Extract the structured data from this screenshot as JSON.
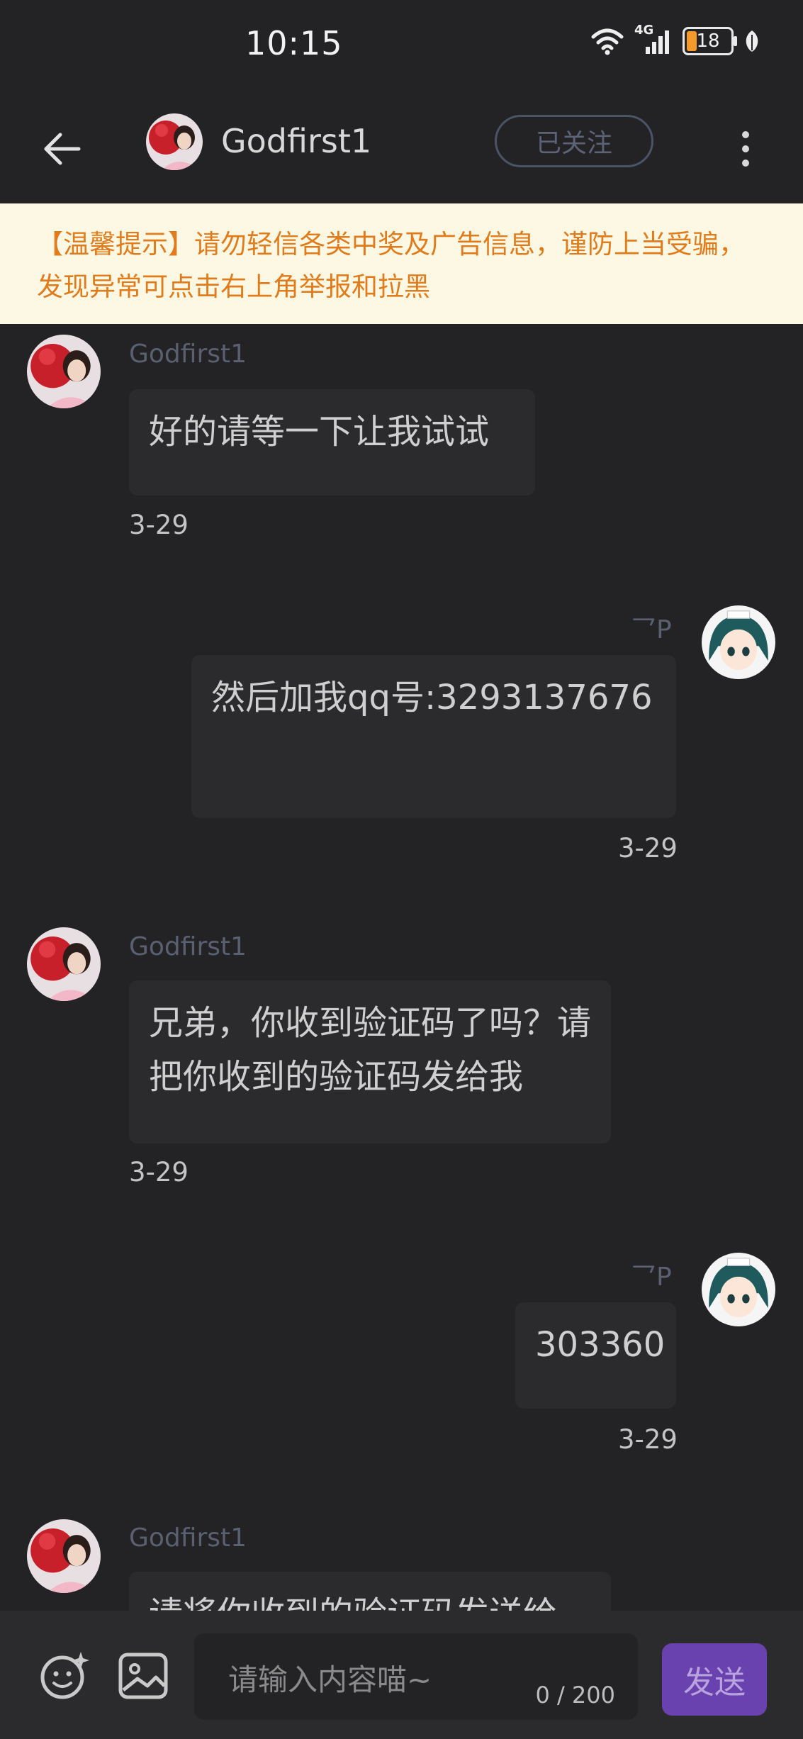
{
  "status_bar": {
    "time": "10:15",
    "network": "4G",
    "battery_level": "18"
  },
  "header": {
    "title": "Godfirst1",
    "follow_label": "已关注"
  },
  "notice": {
    "text": "【温馨提示】请勿轻信各类中奖及广告信息，谨防上当受骗，发现异常可点击右上角举报和拉黑"
  },
  "messages": [
    {
      "side": "left",
      "sender": "Godfirst1",
      "text": "好的请等一下让我试试",
      "time": "3-29"
    },
    {
      "side": "right",
      "sender": "乛P",
      "text": "然后加我qq号:3293137676",
      "time": "3-29"
    },
    {
      "side": "left",
      "sender": "Godfirst1",
      "text": "兄弟，你收到验证码了吗？请把你收到的验证码发给我",
      "time": "3-29"
    },
    {
      "side": "right",
      "sender": "乛P",
      "text": "303360",
      "time": "3-29"
    },
    {
      "side": "left",
      "sender": "Godfirst1",
      "text": "请将你收到的验证码发送给",
      "time": ""
    }
  ],
  "input": {
    "placeholder": "请输入内容喵~",
    "counter": "0 / 200",
    "send_label": "发送"
  },
  "colors": {
    "background": "#232325",
    "bubble": "#2b2b2d",
    "notice_bg": "#fdf8e4",
    "notice_text": "#e07c1c",
    "send_button": "#6a42b0"
  }
}
